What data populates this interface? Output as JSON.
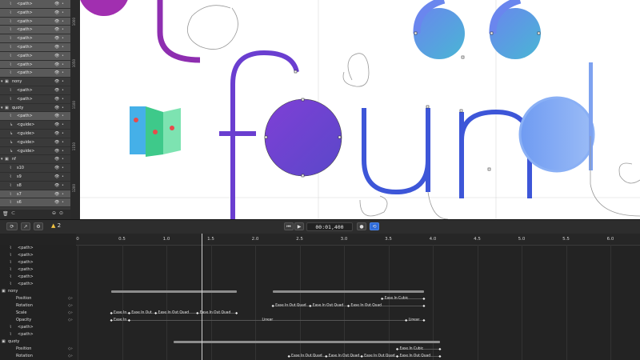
{
  "layers_panel": {
    "rows": [
      {
        "label": "<path>",
        "selected": true,
        "expander": "",
        "type_icon": "path-icon"
      },
      {
        "label": "<path>",
        "selected": true,
        "expander": "",
        "type_icon": "path-icon"
      },
      {
        "label": "<path>",
        "selected": true,
        "expander": "",
        "type_icon": "path-icon"
      },
      {
        "label": "<path>",
        "selected": true,
        "expander": "",
        "type_icon": "path-icon"
      },
      {
        "label": "<path>",
        "selected": true,
        "expander": "",
        "type_icon": "path-icon"
      },
      {
        "label": "<path>",
        "selected": true,
        "expander": "",
        "type_icon": "path-icon"
      },
      {
        "label": "<path>",
        "selected": true,
        "expander": "",
        "type_icon": "path-icon"
      },
      {
        "label": "<path>",
        "selected": true,
        "expander": "",
        "type_icon": "path-icon"
      },
      {
        "label": "<path>",
        "selected": true,
        "expander": "",
        "type_icon": "path-icon"
      },
      {
        "label": "nony",
        "selected": false,
        "expander": "▾",
        "type_icon": "group-icon"
      },
      {
        "label": "<path>",
        "selected": false,
        "expander": "",
        "type_icon": "path-icon"
      },
      {
        "label": "<path>",
        "selected": false,
        "expander": "",
        "type_icon": "path-icon"
      },
      {
        "label": "quoty",
        "selected": false,
        "expander": "▾",
        "type_icon": "group-icon"
      },
      {
        "label": "<path>",
        "selected": true,
        "expander": "",
        "type_icon": "path-icon"
      },
      {
        "label": "<guide>",
        "selected": false,
        "expander": "",
        "type_icon": "guide-icon"
      },
      {
        "label": "<guide>",
        "selected": false,
        "expander": "",
        "type_icon": "guide-icon"
      },
      {
        "label": "<guide>",
        "selected": false,
        "expander": "",
        "type_icon": "guide-icon"
      },
      {
        "label": "<guide>",
        "selected": false,
        "expander": "",
        "type_icon": "guide-icon"
      },
      {
        "label": "nf",
        "selected": false,
        "expander": "▾",
        "type_icon": "group-icon"
      },
      {
        "label": "s10",
        "selected": false,
        "expander": "",
        "type_icon": "path-icon"
      },
      {
        "label": "s9",
        "selected": false,
        "expander": "",
        "type_icon": "path-icon"
      },
      {
        "label": "s8",
        "selected": false,
        "expander": "",
        "type_icon": "path-icon"
      },
      {
        "label": "s7",
        "selected": true,
        "expander": "",
        "type_icon": "path-icon"
      },
      {
        "label": "s6",
        "selected": true,
        "expander": "",
        "type_icon": "path-icon"
      }
    ],
    "footer_icons": [
      "trash-icon",
      "link-icon",
      "more-icon"
    ]
  },
  "ruler_v": {
    "labels": [
      "1000",
      "1050",
      "1100",
      "1150",
      "1200",
      "1250"
    ]
  },
  "toolbar": {
    "left_icons": [
      "rotate-view-icon",
      "export-icon",
      "settings-icon"
    ],
    "warning_count": "2",
    "skip_back": "⏮",
    "play": "▶",
    "timecode": "00:01,400",
    "record": "●",
    "loop": "⟲"
  },
  "timeline": {
    "ruler_ticks": [
      "0",
      "0.5",
      "1.0",
      "1.5",
      "2.0",
      "2.5",
      "3.0",
      "3.5",
      "4.0",
      "4.5",
      "5.0",
      "5.5",
      "6.0"
    ],
    "playhead_time": 1.4,
    "rows": [
      {
        "label": "<path>"
      },
      {
        "label": "<path>"
      },
      {
        "label": "<path>"
      },
      {
        "label": "<path>"
      },
      {
        "label": "<path>"
      },
      {
        "label": "<path>"
      },
      {
        "label": "nony"
      },
      {
        "label": "Position"
      },
      {
        "label": "Rotation"
      },
      {
        "label": "Scale"
      },
      {
        "label": "Opacity"
      },
      {
        "label": "<path>"
      },
      {
        "label": "<path>"
      },
      {
        "label": "quoty"
      },
      {
        "label": "Position"
      },
      {
        "label": "Rotation"
      }
    ],
    "easing_labels": {
      "position": [
        "Ease In Cubic"
      ],
      "rotation": [
        "Ease In Out Quad",
        "Ease In Out Quad",
        "Ease In Out Quad"
      ],
      "scale": [
        "Ease In",
        "Ease In Out",
        "Ease In Out Quad",
        "Ease In Out Quad"
      ],
      "opacity": [
        "Ease In",
        "Linear",
        "Linear"
      ],
      "quoty_position": [
        "Ease In Cubic"
      ],
      "quoty_rotation": [
        "Ease In Out Quad",
        "Ease In Out Quad",
        "Ease In Out Quad",
        "Ease In Out Quad"
      ]
    }
  },
  "colors": {
    "purple": "#8e2eb0",
    "violet": "#6a3ed0",
    "blue": "#3d56d8",
    "light_blue": "#6f9bf2",
    "green": "#3ec98a",
    "teal": "#4fb7c9"
  }
}
